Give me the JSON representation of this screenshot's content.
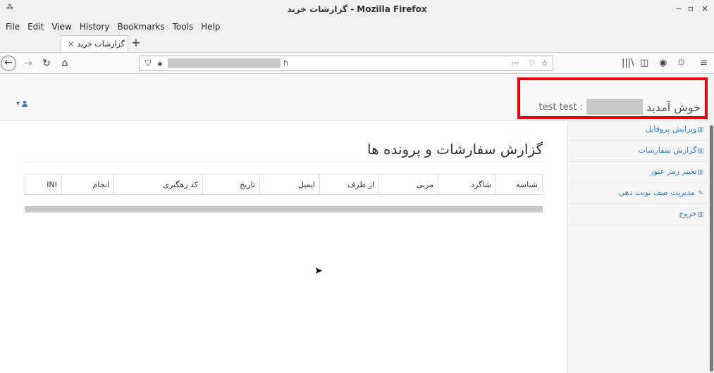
{
  "window": {
    "title": "گزارشات خرید - Mozilla Firefox",
    "app_icon": "pin-icon",
    "controls": {
      "minimize": "‒",
      "maximize": "▫",
      "close": "×"
    }
  },
  "menu": [
    "File",
    "Edit",
    "View",
    "History",
    "Bookmarks",
    "Tools",
    "Help"
  ],
  "tab": {
    "label": "گزارشات خرید",
    "close": "×",
    "new_tab": "+"
  },
  "navbar": {
    "back": "←",
    "forward": "→",
    "reload": "↻",
    "home": "⌂",
    "url_tail": "h",
    "page_actions": "···",
    "pocket": "♡",
    "bookmark": "☆",
    "library": "|||\\",
    "sidebar": "◫",
    "account": "◉",
    "extension": "⚙",
    "menu": "≡"
  },
  "header": {
    "welcome_greeting": "خوش آمدید",
    "welcome_sep": ":",
    "user_name": "test test",
    "user_dropdown_caret": "▾",
    "user_icon": "user-icon"
  },
  "sidebar": {
    "items": [
      {
        "icon": "chart-icon",
        "glyph": "▥",
        "label": "ویرایش پروفایل"
      },
      {
        "icon": "chart-icon",
        "glyph": "▥",
        "label": "گزارش سفارشات"
      },
      {
        "icon": "chart-icon",
        "glyph": "▥",
        "label": "تغییر رمز عبور"
      },
      {
        "icon": "edit-icon",
        "glyph": "✎",
        "label": "مدیریت صف نوبت دهی"
      },
      {
        "icon": "chart-icon",
        "glyph": "▥",
        "label": "خروج"
      }
    ]
  },
  "main": {
    "title": "گزارش سفارشات و پرونده ها",
    "table": {
      "columns": [
        "شناسه",
        "شاگرد",
        "مربی",
        "از طرف",
        "ایمیل",
        "تاریخ",
        "کد رهگیری",
        "انجام",
        "INI"
      ]
    }
  },
  "colors": {
    "link": "#3a7bc0",
    "highlight": "#e8000b",
    "redaction": "#c8c8c8"
  }
}
